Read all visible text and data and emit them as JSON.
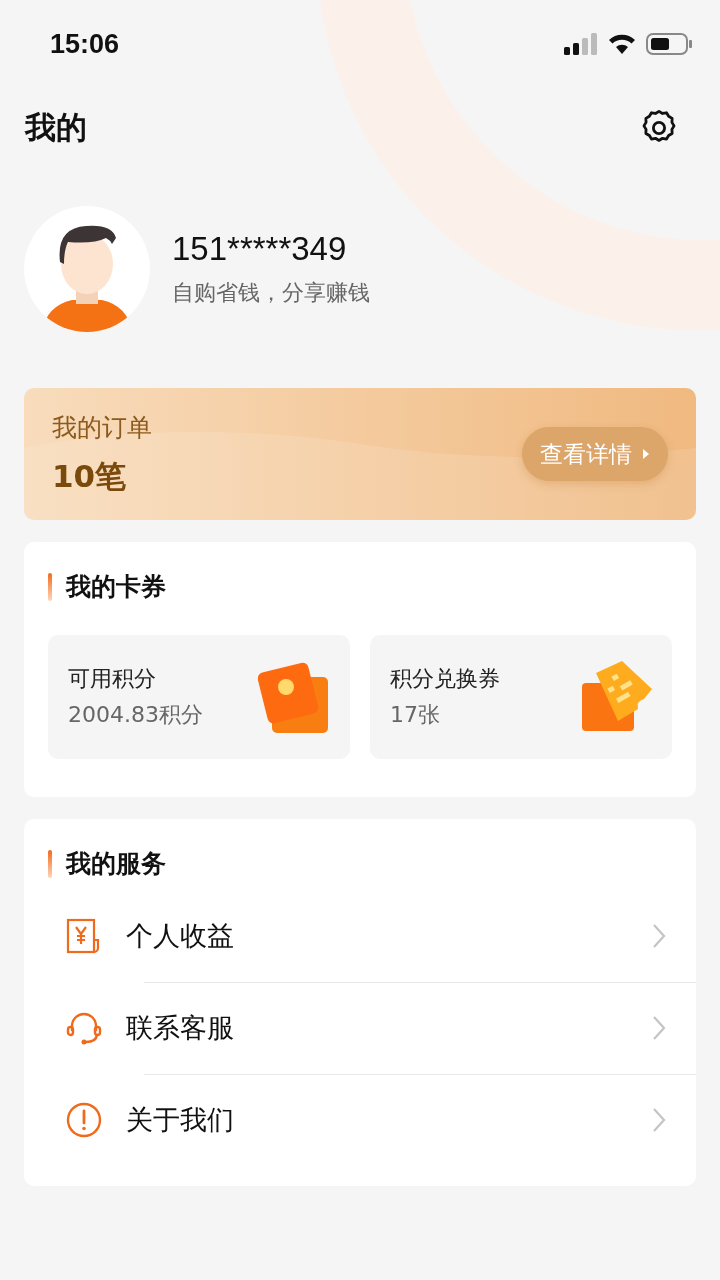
{
  "status_bar": {
    "time": "15:06"
  },
  "header": {
    "title": "我的"
  },
  "profile": {
    "phone": "151*****349",
    "slogan": "自购省钱，分享赚钱"
  },
  "orders": {
    "title": "我的订单",
    "count": "10笔",
    "button": "查看详情"
  },
  "coupons": {
    "title": "我的卡券",
    "items": [
      {
        "kind": "points",
        "label": "可用积分",
        "value": "2004.83积分"
      },
      {
        "kind": "voucher",
        "label": "积分兑换券",
        "value": "17张"
      }
    ]
  },
  "services": {
    "title": "我的服务",
    "items": [
      {
        "kind": "income",
        "label": "个人收益"
      },
      {
        "kind": "support",
        "label": "联系客服"
      },
      {
        "kind": "about",
        "label": "关于我们"
      }
    ]
  }
}
